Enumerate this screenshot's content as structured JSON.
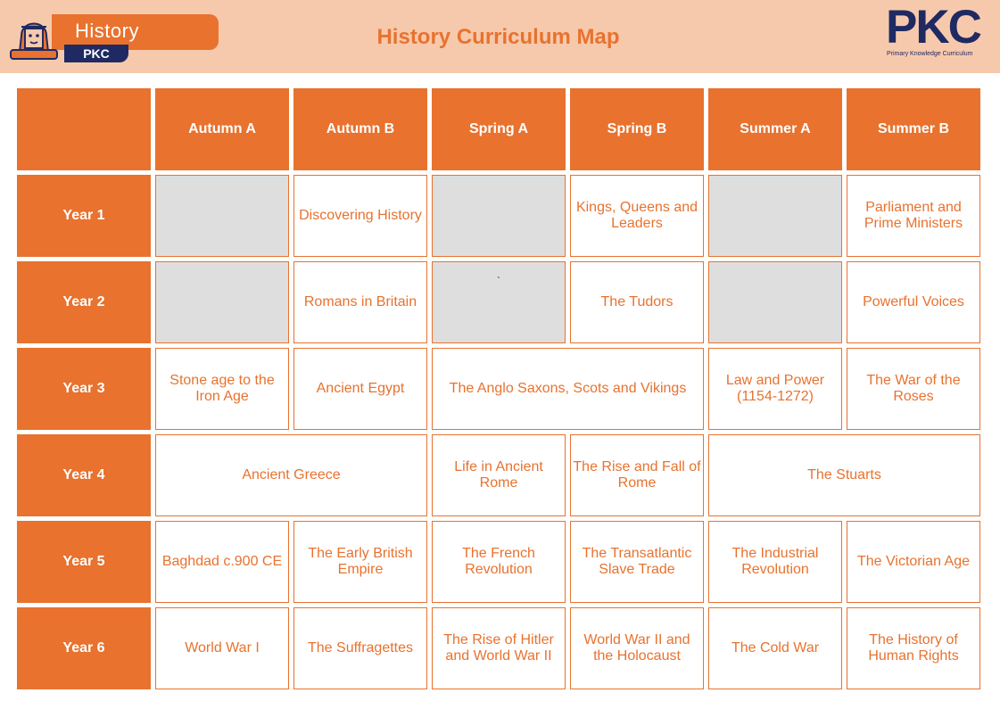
{
  "header": {
    "badge_title": "History",
    "badge_sub": "PKC",
    "page_title": "History Curriculum Map",
    "logo_text": "PKC",
    "logo_sub": "Primary Knowledge Curriculum",
    "colors": {
      "accent": "#e8722e",
      "header_bg": "#f7c9ac",
      "navy": "#1f2a63",
      "empty_cell": "#dedede"
    }
  },
  "table": {
    "columns": [
      "Autumn A",
      "Autumn B",
      "Spring A",
      "Spring B",
      "Summer A",
      "Summer B"
    ],
    "rows": [
      {
        "year": "Year 1",
        "cells": [
          "",
          "Discovering History",
          "",
          "Kings, Queens and Leaders",
          "",
          "Parliament and Prime Ministers"
        ]
      },
      {
        "year": "Year 2",
        "cells": [
          "",
          "Romans in Britain",
          "`",
          "The Tudors",
          "",
          "Powerful Voices"
        ]
      },
      {
        "year": "Year 3",
        "cells": [
          "Stone age to the Iron Age",
          "Ancient Egypt",
          "The Anglo Saxons, Scots and Vikings",
          "Law and Power (1154-1272)",
          "The War of the Roses"
        ]
      },
      {
        "year": "Year 4",
        "cells": [
          "Ancient Greece",
          "Life in Ancient Rome",
          "The Rise and Fall of Rome",
          "The Stuarts"
        ]
      },
      {
        "year": "Year 5",
        "cells": [
          "Baghdad c.900 CE",
          "The Early British Empire",
          "The French Revolution",
          "The Transatlantic Slave Trade",
          "The Industrial Revolution",
          "The Victorian Age"
        ]
      },
      {
        "year": "Year 6",
        "cells": [
          "World War I",
          "The Suffragettes",
          "The Rise of Hitler and World War II",
          "World War II and the Holocaust",
          "The Cold War",
          "The History of Human Rights"
        ]
      }
    ]
  }
}
